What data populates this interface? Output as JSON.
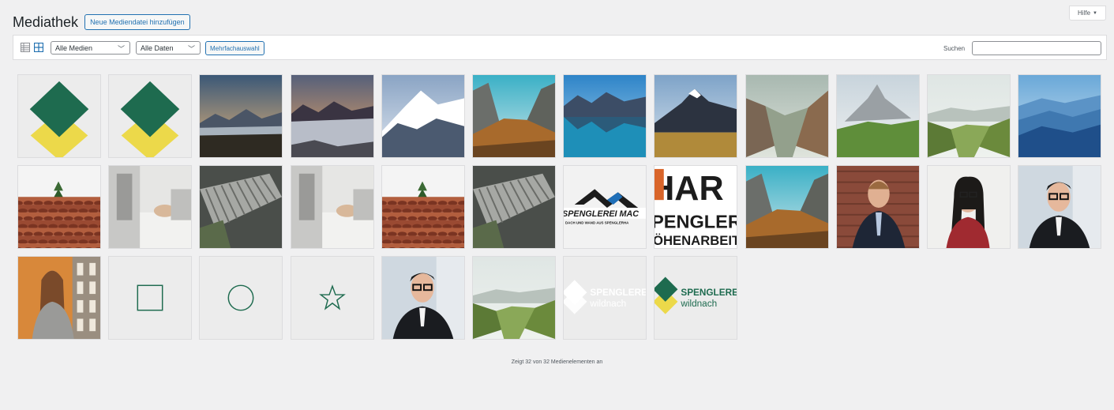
{
  "header": {
    "title": "Mediathek",
    "add_button": "Neue Mediendatei hinzufügen",
    "help": "Hilfe",
    "help_arrow": "▼"
  },
  "toolbar": {
    "filter_type": "Alle Medien",
    "filter_date": "Alle Daten",
    "chevron": "﹀",
    "bulk_select": "Mehrfachauswahl",
    "search_label": "Suchen",
    "search_value": ""
  },
  "media_items": [
    {
      "kind": "diamond-logo"
    },
    {
      "kind": "diamond-logo"
    },
    {
      "kind": "landscape-dusk-lake"
    },
    {
      "kind": "landscape-fog-sunset"
    },
    {
      "kind": "landscape-snow-peak"
    },
    {
      "kind": "landscape-valley-forest"
    },
    {
      "kind": "landscape-lake-reflection"
    },
    {
      "kind": "landscape-peak-meadow"
    },
    {
      "kind": "landscape-canyon"
    },
    {
      "kind": "landscape-alpine-green"
    },
    {
      "kind": "landscape-green-valley"
    },
    {
      "kind": "landscape-blue-ridges"
    },
    {
      "kind": "roof-tiles"
    },
    {
      "kind": "workshop"
    },
    {
      "kind": "factory-roof"
    },
    {
      "kind": "workshop"
    },
    {
      "kind": "roof-tiles"
    },
    {
      "kind": "factory-roof"
    },
    {
      "kind": "logo-spenglerei-mac",
      "text": "SPENGLEREI MAC",
      "subtext": "DACH UND WAND AUS SPENGLERHA"
    },
    {
      "kind": "logo-har",
      "text": "HAR",
      "subtext": "PENGLER",
      "subtext2": "ÖHENARBEIT"
    },
    {
      "kind": "landscape-valley-forest"
    },
    {
      "kind": "portrait-man-suit"
    },
    {
      "kind": "portrait-woman-glasses"
    },
    {
      "kind": "portrait-man-glasses"
    },
    {
      "kind": "portrait-woman-orange"
    },
    {
      "kind": "icon-square"
    },
    {
      "kind": "icon-circle"
    },
    {
      "kind": "icon-star"
    },
    {
      "kind": "portrait-man-glasses"
    },
    {
      "kind": "landscape-green-valley"
    },
    {
      "kind": "logo-wildnach-white",
      "text": "SPENGLEREI",
      "subtext": "wildnach"
    },
    {
      "kind": "logo-wildnach-green",
      "text": "SPENGLEREI",
      "subtext": "wildnach"
    }
  ],
  "footer": {
    "status": "Zeigt 32 von 32 Medienelementen an"
  },
  "colors": {
    "accent": "#2271b1",
    "brand_green": "#1e6b4f",
    "brand_yellow": "#ecd94a"
  }
}
